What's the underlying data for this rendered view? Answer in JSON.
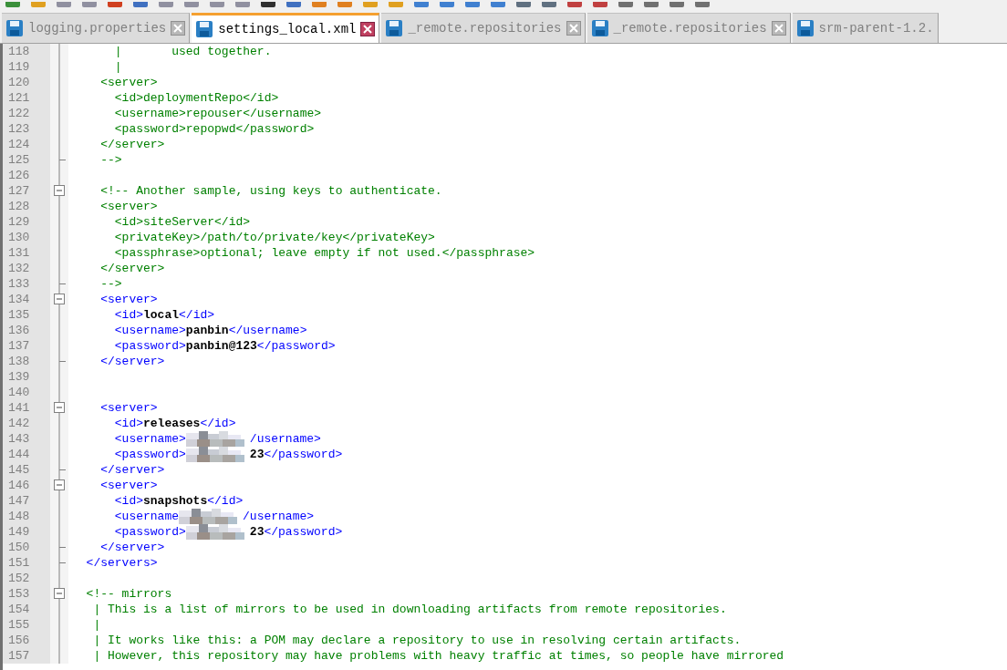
{
  "tabs": [
    {
      "label": "logging.properties",
      "selected": false
    },
    {
      "label": "settings_local.xml",
      "selected": true
    },
    {
      "label": "_remote.repositories",
      "selected": false
    },
    {
      "label": "_remote.repositories",
      "selected": false
    },
    {
      "label": "srm-parent-1.2.",
      "selected": false
    }
  ],
  "editor": {
    "lines": [
      {
        "number": "118",
        "kind": "line",
        "segments": [
          {
            "kind": "comment",
            "text": "      |       used together."
          }
        ]
      },
      {
        "number": "119",
        "kind": "line",
        "segments": [
          {
            "kind": "comment",
            "text": "      |"
          }
        ]
      },
      {
        "number": "120",
        "kind": "line",
        "segments": [
          {
            "kind": "comment",
            "text": "    <server>"
          }
        ]
      },
      {
        "number": "121",
        "kind": "line",
        "segments": [
          {
            "kind": "comment",
            "text": "      <id>deploymentRepo</id>"
          }
        ]
      },
      {
        "number": "122",
        "kind": "line",
        "segments": [
          {
            "kind": "comment",
            "text": "      <username>repouser</username>"
          }
        ]
      },
      {
        "number": "123",
        "kind": "line",
        "segments": [
          {
            "kind": "comment",
            "text": "      <password>repopwd</password>"
          }
        ]
      },
      {
        "number": "124",
        "kind": "line",
        "segments": [
          {
            "kind": "comment",
            "text": "    </server>"
          }
        ]
      },
      {
        "number": "125",
        "kind": "end",
        "segments": [
          {
            "kind": "comment",
            "text": "    -->"
          }
        ]
      },
      {
        "number": "126",
        "kind": "line"
      },
      {
        "number": "127",
        "kind": "box",
        "segments": [
          {
            "kind": "comment",
            "text": "    <!-- Another sample, using keys to authenticate."
          }
        ]
      },
      {
        "number": "128",
        "kind": "line",
        "segments": [
          {
            "kind": "comment",
            "text": "    <server>"
          }
        ]
      },
      {
        "number": "129",
        "kind": "line",
        "segments": [
          {
            "kind": "comment",
            "text": "      <id>siteServer</id>"
          }
        ]
      },
      {
        "number": "130",
        "kind": "line",
        "segments": [
          {
            "kind": "comment",
            "text": "      <privateKey>/path/to/private/key</privateKey>"
          }
        ]
      },
      {
        "number": "131",
        "kind": "line",
        "segments": [
          {
            "kind": "comment",
            "text": "      <passphrase>optional; leave empty if not used.</passphrase>"
          }
        ]
      },
      {
        "number": "132",
        "kind": "line",
        "segments": [
          {
            "kind": "comment",
            "text": "    </server>"
          }
        ]
      },
      {
        "number": "133",
        "kind": "end",
        "segments": [
          {
            "kind": "comment",
            "text": "    -->"
          }
        ]
      },
      {
        "number": "134",
        "kind": "box",
        "segments": [
          {
            "kind": "tag",
            "text": "    <server>"
          }
        ]
      },
      {
        "number": "135",
        "kind": "line",
        "segments": [
          {
            "kind": "tag",
            "text": "      <id>"
          },
          {
            "kind": "value",
            "text": "local"
          },
          {
            "kind": "tag",
            "text": "</id>"
          }
        ]
      },
      {
        "number": "136",
        "kind": "line",
        "segments": [
          {
            "kind": "tag",
            "text": "      <username>"
          },
          {
            "kind": "value",
            "text": "panbin"
          },
          {
            "kind": "tag",
            "text": "</username>"
          }
        ]
      },
      {
        "number": "137",
        "kind": "line",
        "segments": [
          {
            "kind": "tag",
            "text": "      <password>"
          },
          {
            "kind": "value",
            "text": "panbin@123"
          },
          {
            "kind": "tag",
            "text": "</password>"
          }
        ]
      },
      {
        "number": "138",
        "kind": "end",
        "segments": [
          {
            "kind": "tag",
            "text": "    </server>"
          }
        ]
      },
      {
        "number": "139",
        "kind": "line"
      },
      {
        "number": "140",
        "kind": "line"
      },
      {
        "number": "141",
        "kind": "box",
        "segments": [
          {
            "kind": "tag",
            "text": "    <server>"
          }
        ]
      },
      {
        "number": "142",
        "kind": "line",
        "segments": [
          {
            "kind": "tag",
            "text": "      <id>"
          },
          {
            "kind": "value",
            "text": "releases"
          },
          {
            "kind": "tag",
            "text": "</id>"
          }
        ]
      },
      {
        "number": "143",
        "kind": "line",
        "segments": [
          {
            "kind": "tag",
            "text": "      <username>"
          },
          {
            "kind": "redacted"
          },
          {
            "kind": "tag",
            "text": "/username>"
          }
        ]
      },
      {
        "number": "144",
        "kind": "line",
        "segments": [
          {
            "kind": "tag",
            "text": "      <password>"
          },
          {
            "kind": "redacted"
          },
          {
            "kind": "value",
            "text": "23"
          },
          {
            "kind": "tag",
            "text": "</password>"
          }
        ]
      },
      {
        "number": "145",
        "kind": "end",
        "segments": [
          {
            "kind": "tag",
            "text": "    </server>"
          }
        ]
      },
      {
        "number": "146",
        "kind": "box",
        "segments": [
          {
            "kind": "tag",
            "text": "    <server>"
          }
        ]
      },
      {
        "number": "147",
        "kind": "line",
        "segments": [
          {
            "kind": "tag",
            "text": "      <id>"
          },
          {
            "kind": "value",
            "text": "snapshots"
          },
          {
            "kind": "tag",
            "text": "</id>"
          }
        ]
      },
      {
        "number": "148",
        "kind": "line",
        "segments": [
          {
            "kind": "tag",
            "text": "      <username"
          },
          {
            "kind": "redacted"
          },
          {
            "kind": "tag",
            "text": "/username>"
          }
        ]
      },
      {
        "number": "149",
        "kind": "line",
        "segments": [
          {
            "kind": "tag",
            "text": "      <password>"
          },
          {
            "kind": "redacted"
          },
          {
            "kind": "value",
            "text": "23"
          },
          {
            "kind": "tag",
            "text": "</password>"
          }
        ]
      },
      {
        "number": "150",
        "kind": "end",
        "segments": [
          {
            "kind": "tag",
            "text": "    </server>"
          }
        ]
      },
      {
        "number": "151",
        "kind": "end",
        "segments": [
          {
            "kind": "tag",
            "text": "  </servers>"
          }
        ]
      },
      {
        "number": "152",
        "kind": "line"
      },
      {
        "number": "153",
        "kind": "box",
        "segments": [
          {
            "kind": "comment",
            "text": "  <!-- mirrors"
          }
        ]
      },
      {
        "number": "154",
        "kind": "line",
        "segments": [
          {
            "kind": "comment",
            "text": "   | This is a list of mirrors to be used in downloading artifacts from remote repositories."
          }
        ]
      },
      {
        "number": "155",
        "kind": "line",
        "segments": [
          {
            "kind": "comment",
            "text": "   |"
          }
        ]
      },
      {
        "number": "156",
        "kind": "line",
        "segments": [
          {
            "kind": "comment",
            "text": "   | It works like this: a POM may declare a repository to use in resolving certain artifacts."
          }
        ]
      },
      {
        "number": "157",
        "kind": "line",
        "segments": [
          {
            "kind": "comment",
            "text": "   | However, this repository may have problems with heavy traffic at times, so people have mirrored"
          }
        ]
      }
    ]
  }
}
